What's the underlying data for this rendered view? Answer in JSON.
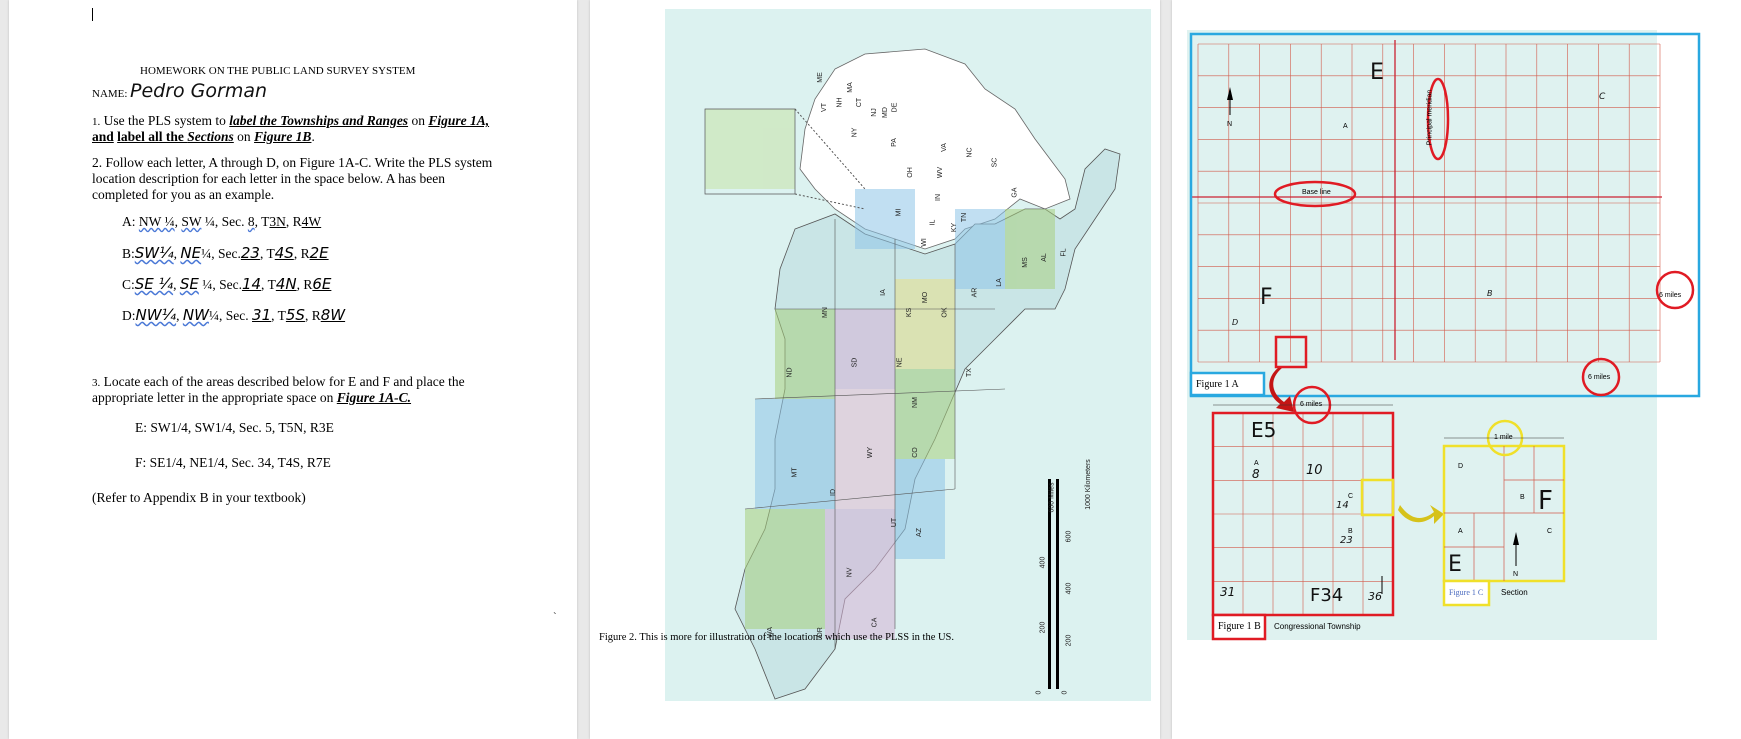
{
  "page1": {
    "title": "HOMEWORK ON THE PUBLIC LAND SURVEY SYSTEM",
    "name_label": "NAME:",
    "name_value": "Pedro Gorman",
    "q1": {
      "num": "1.",
      "t1": "Use the PLS system to ",
      "b1": "label the Townships and Ranges",
      "t2": " on ",
      "b2": "Figure 1A,",
      "b3": "and",
      "b4": "label all the ",
      "b5": "Sections",
      "t3": " on ",
      "b6": "Figure 1B",
      "t4": "."
    },
    "q2": {
      "line1": "2.  Follow each letter, A through D, on Figure 1A-C.  Write the PLS system",
      "line2": "location description for each letter in the space below.  A has been",
      "line3": "completed for you as an example.",
      "A": {
        "prefix": "A:",
        "q1": "NW ¼",
        "q2": "SW",
        "rest": "¼, Sec.",
        "sec": "8",
        "t": "T",
        "tval": "3N",
        "r": "R",
        "rval": "4W"
      },
      "B": {
        "prefix": "B:",
        "q1": "SW¼",
        "q2": "NE",
        "rest": "¼, Sec.",
        "sec": "23",
        "t": "T",
        "tval": "4S",
        "r": "R",
        "rval": "2E"
      },
      "C": {
        "prefix": "C:",
        "q1": "SE ¼",
        "q2": "SE",
        "rest": "¼, Sec.",
        "sec": "14",
        "t": "T",
        "tval": "4N",
        "r": "R",
        "rval": "6E"
      },
      "D": {
        "prefix": "D:",
        "q1": "NW¼",
        "q2": "NW",
        "rest": "¼, Sec.",
        "sec": "31",
        "t": "T",
        "tval": "5S",
        "r": "R",
        "rval": "8W"
      }
    },
    "q3": {
      "num": "3.",
      "line1": "Locate each of the areas described below for E and F and place the",
      "line2": "appropriate letter in the appropriate space on ",
      "fig": "Figure 1A-C.",
      "E": "E:  SW1/4, SW1/4, Sec. 5, T5N, R3E",
      "F": "F:  SE1/4, NE1/4, Sec. 34, T4S, R7E"
    },
    "refer": "(Refer to Appendix B in your textbook)"
  },
  "page2": {
    "caption": "Figure 2.  This is more for illustration of the locations which use the PLSS in the US.",
    "states": [
      "WA",
      "OR",
      "CA",
      "NV",
      "ID",
      "MT",
      "WY",
      "UT",
      "AZ",
      "CO",
      "NM",
      "ND",
      "SD",
      "NE",
      "KS",
      "OK",
      "TX",
      "MN",
      "IA",
      "MO",
      "AR",
      "LA",
      "WI",
      "IL",
      "MI",
      "IN",
      "OH",
      "KY",
      "TN",
      "MS",
      "AL",
      "FL",
      "GA",
      "SC",
      "NC",
      "VA",
      "WV",
      "PA",
      "NY",
      "VT",
      "NH",
      "ME",
      "MA",
      "CT",
      "NJ",
      "MD",
      "DE"
    ],
    "scale_miles": [
      "0",
      "200",
      "400",
      "600 Miles"
    ],
    "scale_km": [
      "0",
      "200",
      "400",
      "600",
      "1000 Kilometers"
    ]
  },
  "page3": {
    "figA": {
      "label": "Figure 1 A",
      "base_line": "Base line",
      "principal_meridian": "Principal meridian",
      "six_miles_a": "6 miles",
      "six_miles_b": "6 miles",
      "north": "N",
      "marker_a": "A",
      "hand_e": "E",
      "hand_f": "F",
      "hand_c": "C",
      "hand_b": "B",
      "hand_d": "D"
    },
    "figB": {
      "label": "Figure 1 B",
      "caption": "Congressional Township",
      "six_miles": "6 miles",
      "marker_a": "A",
      "marker_c": "C",
      "marker_b": "B",
      "hand_e5": "E5",
      "hand_8": "8",
      "hand_10": "10",
      "hand_14": "14",
      "hand_23": "23",
      "hand_31": "31",
      "hand_f34": "F34",
      "hand_36": "36"
    },
    "figC": {
      "label": "Figure 1 C",
      "caption": "Section",
      "one_mile": "1 mile",
      "d": "D",
      "b": "B",
      "a": "A",
      "c": "C",
      "n": "N",
      "hand_f": "F",
      "hand_e": "E"
    },
    "colors": {
      "figA_box": "#29a8e0",
      "figB_box": "#e01b24",
      "figC_box": "#f0e02a",
      "grid": "#d25a4a",
      "paper": "#dff2f0"
    }
  }
}
